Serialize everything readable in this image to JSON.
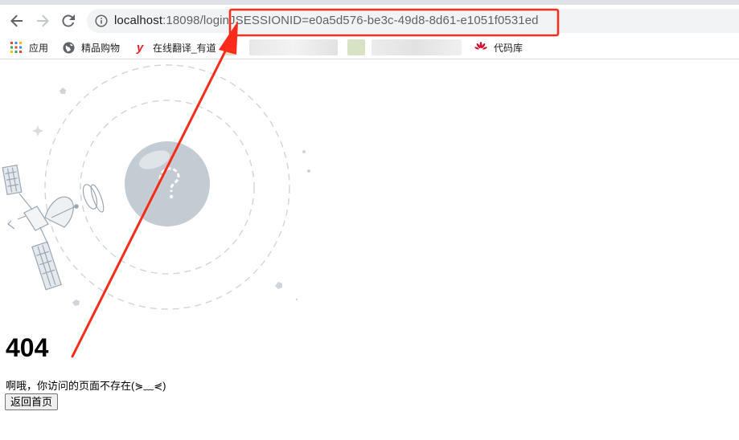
{
  "browser": {
    "url_host": "localhost",
    "url_rest": ":18098/loginJSESSIONID=e0a5d576-be3c-49d8-8d61-e1051f0531ed",
    "bookmarks": [
      {
        "label": "应用",
        "icon": "apps-grid-icon"
      },
      {
        "label": "精品购物",
        "icon": "globe-icon"
      },
      {
        "label": "在线翻译_有道",
        "icon": "youdao-icon"
      },
      {
        "label": "代码库",
        "icon": "huawei-icon"
      }
    ]
  },
  "page": {
    "error_code": "404",
    "message": "啊哦，你访问的页面不存在(⋟﹏⋞)",
    "home_button": "返回首页"
  },
  "colors": {
    "annotation_red": "#ff2a1a",
    "illustration_gray": "#c4ccd3",
    "accent_youdao": "#e8202a",
    "huawei_red": "#cf0a2c"
  }
}
